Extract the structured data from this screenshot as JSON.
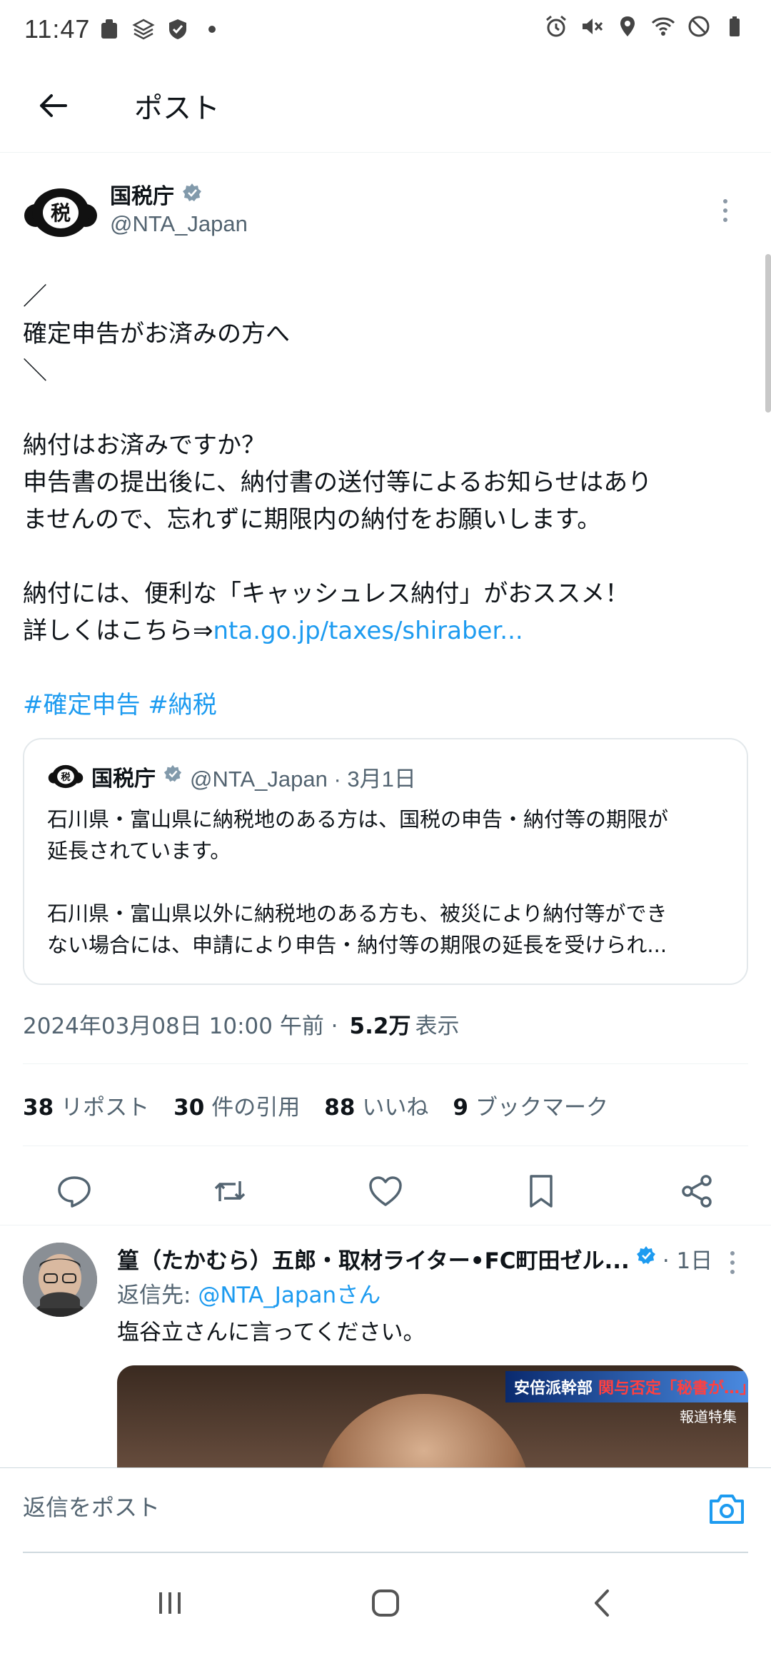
{
  "status_bar": {
    "time": "11:47",
    "left_icons": [
      "notification-icon",
      "layers-icon",
      "shield-icon",
      "dot-icon"
    ],
    "right_icons": [
      "alarm-icon",
      "vibrate-mute-icon",
      "location-icon",
      "wifi-icon",
      "dnd-icon",
      "battery-icon"
    ]
  },
  "header": {
    "title": "ポスト"
  },
  "post": {
    "author_name": "国税庁",
    "author_handle": "@NTA_Japan",
    "avatar_text": "税",
    "lines": [
      "／",
      "確定申告がお済みの方へ",
      "＼",
      "",
      "納付はお済みですか？",
      "申告書の提出後に、納付書の送付等によるお知らせはあり",
      "ませんので、忘れずに期限内の納付をお願いします。",
      "",
      "納付には、便利な「キャッシュレス納付」がおススメ！"
    ],
    "link_prefix": "詳しくはこちら⇒",
    "link_text": "nta.go.jp/taxes/shiraber...",
    "hashtags": "#確定申告 #納税"
  },
  "quote": {
    "author_name": "国税庁",
    "meta": "@NTA_Japan · 3月1日",
    "lines": [
      "石川県・富山県に納税地のある方は、国税の申告・納付等の期限が",
      "延長されています。",
      "",
      "石川県・富山県以外に納税地のある方も、被災により納付等ができ",
      "ない場合には、申請により申告・納付等の期限の延長を受けられ..."
    ]
  },
  "timestamp": {
    "datetime": "2024年03月08日 10:00 午前 ·",
    "views_count": "5.2万",
    "views_label": "表示"
  },
  "stats": {
    "reposts_count": "38",
    "reposts_label": "リポスト",
    "quotes_count": "30",
    "quotes_label": "件の引用",
    "likes_count": "88",
    "likes_label": "いいね",
    "bookmarks_count": "9",
    "bookmarks_label": "ブックマーク"
  },
  "reply": {
    "author_name": "篁（たかむら）五郎・取材ライター•FC町田ゼル...",
    "time": "· 1日",
    "replying_to_label": "返信先: ",
    "replying_to_handle": "@NTA_Japanさん",
    "text": "塩谷立さんに言ってください。",
    "media_banner": "安倍派幹部",
    "media_banner_red": "関与否定「秘書が…」",
    "media_sub": "報道特集"
  },
  "composer": {
    "placeholder": "返信をポスト"
  },
  "colors": {
    "accent": "#1d9bf0",
    "secondary_text": "#536471",
    "primary_text": "#0f1419"
  }
}
